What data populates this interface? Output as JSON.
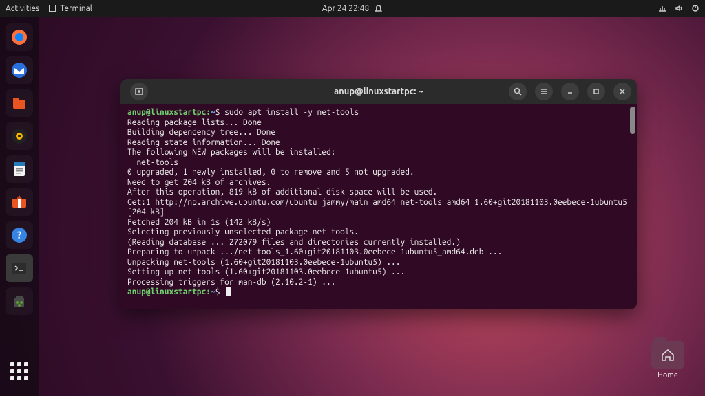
{
  "topbar": {
    "activities": "Activities",
    "app_label": "Terminal",
    "datetime": "Apr 24  22:48"
  },
  "home_folder": {
    "label": "Home"
  },
  "terminal": {
    "title": "anup@linuxstartpc: ~",
    "prompt_user_host": "anup@linuxstartpc:",
    "prompt_path": "~",
    "prompt_symbol": "$",
    "command": "sudo apt install -y net-tools",
    "output": [
      "Reading package lists... Done",
      "Building dependency tree... Done",
      "Reading state information... Done",
      "The following NEW packages will be installed:",
      "  net-tools",
      "0 upgraded, 1 newly installed, 0 to remove and 5 not upgraded.",
      "Need to get 204 kB of archives.",
      "After this operation, 819 kB of additional disk space will be used.",
      "Get:1 http://np.archive.ubuntu.com/ubuntu jammy/main amd64 net-tools amd64 1.60+git20181103.0eebece-1ubuntu5 [204 kB]",
      "Fetched 204 kB in 1s (142 kB/s)",
      "Selecting previously unselected package net-tools.",
      "(Reading database ... 272079 files and directories currently installed.)",
      "Preparing to unpack .../net-tools_1.60+git20181103.0eebece-1ubuntu5_amd64.deb ...",
      "Unpacking net-tools (1.60+git20181103.0eebece-1ubuntu5) ...",
      "Setting up net-tools (1.60+git20181103.0eebece-1ubuntu5) ...",
      "Processing triggers for man-db (2.10.2-1) ..."
    ]
  },
  "dock": {
    "items": [
      "firefox",
      "thunderbird",
      "files",
      "rhythmbox",
      "writer",
      "software",
      "help",
      "terminal",
      "trash"
    ]
  }
}
